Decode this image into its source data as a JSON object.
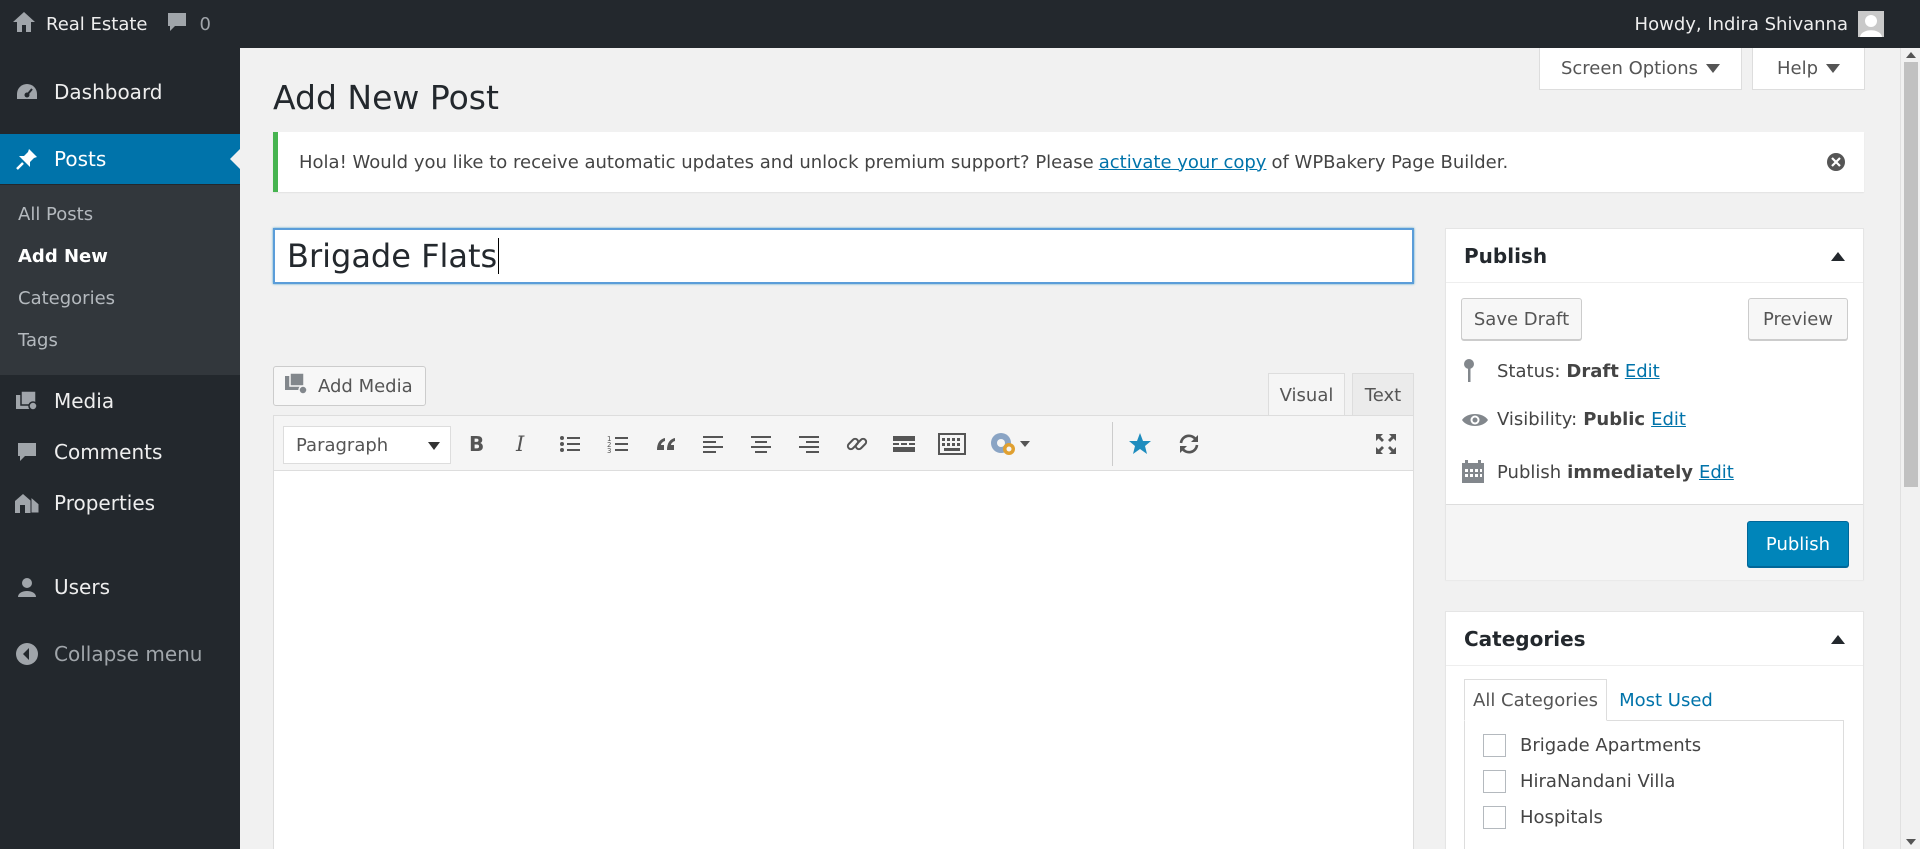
{
  "adminbar": {
    "site_name": "Real Estate",
    "comment_count": "0",
    "greeting": "Howdy, Indira Shivanna"
  },
  "sidebar": {
    "dashboard": "Dashboard",
    "posts": "Posts",
    "submenu": [
      "All Posts",
      "Add New",
      "Categories",
      "Tags"
    ],
    "media": "Media",
    "comments": "Comments",
    "properties": "Properties",
    "users": "Users",
    "collapse": "Collapse menu"
  },
  "screen_meta": {
    "screen_options": "Screen Options",
    "help": "Help"
  },
  "page": {
    "title": "Add New Post"
  },
  "notice": {
    "text_before": "Hola! Would you like to receive automatic updates and unlock premium support? Please",
    "link": "activate your copy",
    "text_after": "of WPBakery Page Builder."
  },
  "post": {
    "title_value": "Brigade Flats"
  },
  "editor": {
    "add_media": "Add Media",
    "tab_visual": "Visual",
    "tab_text": "Text",
    "format_value": "Paragraph",
    "active_tab": "Visual"
  },
  "publish_box": {
    "title": "Publish",
    "save_draft": "Save Draft",
    "preview": "Preview",
    "status_label": "Status:",
    "status_value": "Draft",
    "visibility_label": "Visibility:",
    "visibility_value": "Public",
    "publish_label": "Publish",
    "publish_value": "immediately",
    "edit": "Edit",
    "publish_button": "Publish"
  },
  "categories_box": {
    "title": "Categories",
    "tab_all": "All Categories",
    "tab_most_used": "Most Used",
    "items": [
      "Brigade Apartments",
      "HiraNandani Villa",
      "Hospitals"
    ]
  },
  "colors": {
    "admin_bar": "#23282d",
    "accent": "#0073aa",
    "primary_button": "#0085ba",
    "notice_border": "#46b450"
  }
}
